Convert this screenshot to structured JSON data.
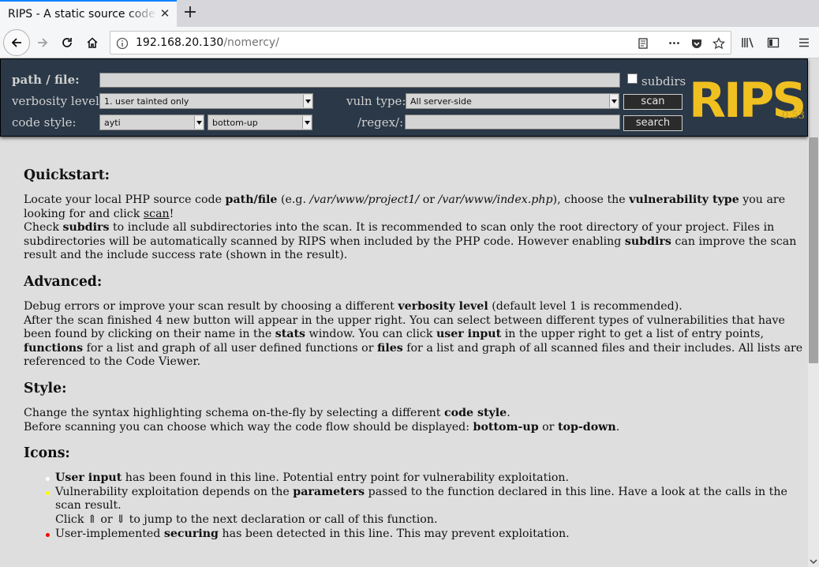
{
  "browser": {
    "tab_title": "RIPS - A static source code analyser",
    "url_host": "192.168.20.130",
    "url_path": "/nomercy/",
    "tab_close_glyph": "✕",
    "new_tab_glyph": "+",
    "more_glyph": "•••"
  },
  "rips_form": {
    "path_label": "path / file:",
    "path_value": "",
    "subdirs_label": "subdirs",
    "verbosity_label": "verbosity level:",
    "verbosity_value": "1. user tainted only",
    "vuln_type_label": "vuln type:",
    "vuln_type_value": "All server-side",
    "scan_label": "scan",
    "code_style_label": "code style:",
    "code_style_value": "ayti",
    "flow_value": "bottom-up",
    "regex_label": "/regex/:",
    "regex_value": "",
    "search_label": "search",
    "logo_text": "RIPS",
    "version": "0.53"
  },
  "content": {
    "quickstart": {
      "heading": "Quickstart:",
      "p1_a": "Locate your local PHP source code ",
      "p1_b": "path/file",
      "p1_c": " (e.g. ",
      "p1_d": "/var/www/project1/",
      "p1_e": " or ",
      "p1_f": "/var/www/index.php",
      "p1_g": "), choose the ",
      "p1_h": "vulnerability type",
      "p1_i": " you are looking for and click ",
      "p1_j": "scan",
      "p1_k": "!",
      "p2_a": "Check ",
      "p2_b": "subdirs",
      "p2_c": " to include all subdirectories into the scan. It is recommended to scan only the root directory of your project. Files in subdirectories will be automatically scanned by RIPS when included by the PHP code. However enabling ",
      "p2_d": "subdirs",
      "p2_e": " can improve the scan result and the include success rate (shown in the result)."
    },
    "advanced": {
      "heading": "Advanced:",
      "p1_a": "Debug errors or improve your scan result by choosing a different ",
      "p1_b": "verbosity level",
      "p1_c": " (default level 1 is recommended).",
      "p2_a": "After the scan finished 4 new button will appear in the upper right. You can select between different types of vulnerabilities that have been found by clicking on their name in the ",
      "p2_b": "stats",
      "p2_c": " window. You can click ",
      "p2_d": "user input",
      "p2_e": " in the upper right to get a list of entry points, ",
      "p2_f": "functions",
      "p2_g": " for a list and graph of all user defined functions or ",
      "p2_h": "files",
      "p2_i": " for a list and graph of all scanned files and their includes. All lists are referenced to the Code Viewer."
    },
    "style": {
      "heading": "Style:",
      "p1_a": "Change the syntax highlighting schema on-the-fly by selecting a different ",
      "p1_b": "code style",
      "p1_c": ".",
      "p2_a": "Before scanning you can choose which way the code flow should be displayed: ",
      "p2_b": "bottom-up",
      "p2_c": " or ",
      "p2_d": "top-down",
      "p2_e": "."
    },
    "icons": {
      "heading": "Icons:",
      "item1_a": "User input",
      "item1_b": " has been found in this line. Potential entry point for vulnerability exploitation.",
      "item2_a": "Vulnerability exploitation depends on the ",
      "item2_b": "parameters",
      "item2_c": " passed to the function declared in this line. Have a look at the calls in the scan result.",
      "item2_d": "Click ⇑ or ⇓ to jump to the next declaration or call of this function.",
      "item3_a": "User-implemented ",
      "item3_b": "securing",
      "item3_c": " has been detected in this line. This may prevent exploitation.",
      "dot_colors": [
        "#ffffff",
        "#ffff00",
        "#ff0000"
      ]
    }
  }
}
